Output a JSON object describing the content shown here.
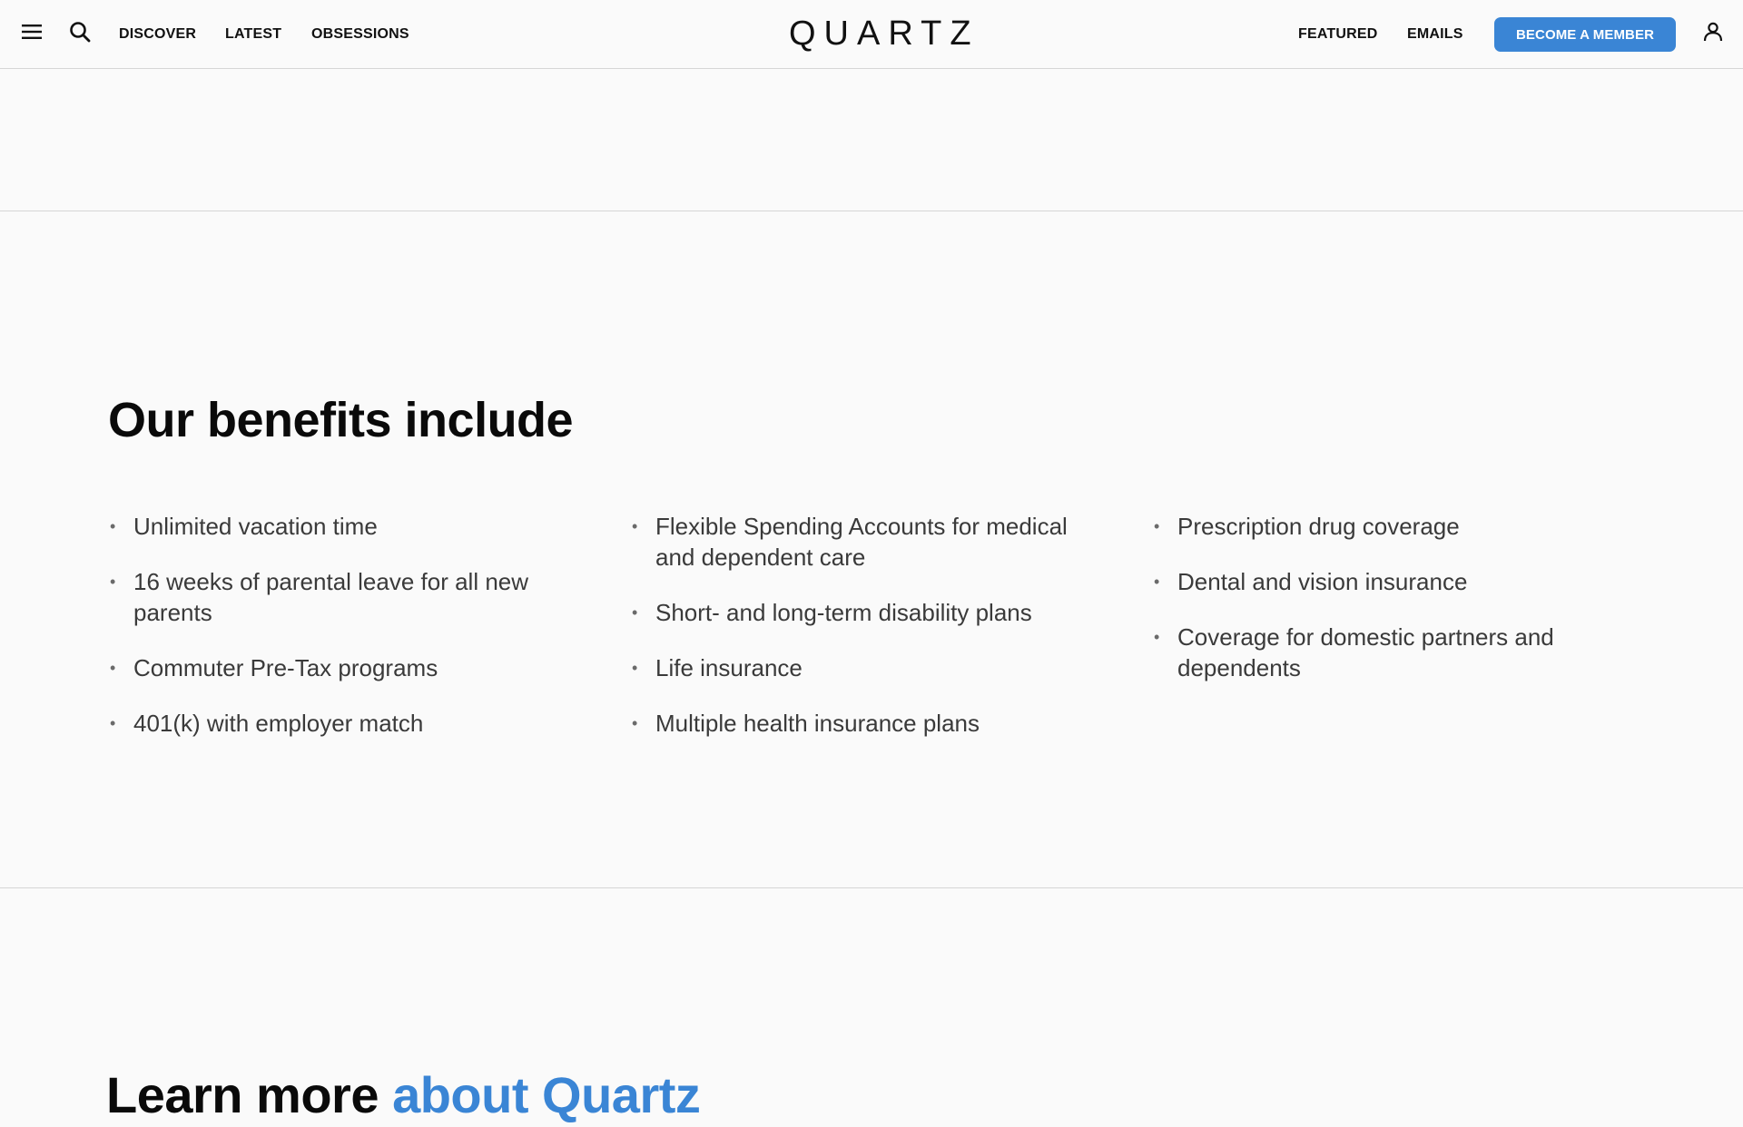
{
  "header": {
    "logo": "QUARTZ",
    "nav_left": [
      "DISCOVER",
      "LATEST",
      "OBSESSIONS"
    ],
    "nav_right": [
      "FEATURED",
      "EMAILS"
    ],
    "member_button": "BECOME A MEMBER",
    "icons": {
      "menu": "hamburger-menu-icon",
      "search": "search-icon",
      "user": "user-account-icon"
    }
  },
  "benefits": {
    "title": "Our benefits include",
    "columns": [
      [
        "Unlimited vacation time",
        "16 weeks of parental leave for all new parents",
        "Commuter Pre-Tax programs",
        "401(k) with employer match"
      ],
      [
        "Flexible Spending Accounts for medical and dependent care",
        "Short- and long-term disability plans",
        "Life insurance",
        "Multiple health insurance plans"
      ],
      [
        "Prescription drug coverage",
        "Dental and vision insurance",
        "Coverage for domestic partners and dependents"
      ]
    ]
  },
  "learn_more": {
    "text": "Learn more ",
    "accent_text": "about Quartz"
  },
  "colors": {
    "background": "#fafafa",
    "accent": "#3a85d5",
    "divider": "#d6d6d6",
    "body_text": "#3a3a3a"
  }
}
